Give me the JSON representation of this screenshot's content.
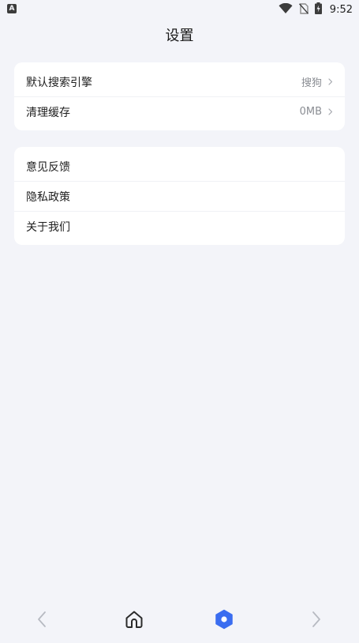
{
  "status_bar": {
    "left_icon_letter": "A",
    "time": "9:52",
    "icons": [
      "wifi-icon",
      "no-sim-icon",
      "battery-charging-icon"
    ]
  },
  "page": {
    "title": "设置"
  },
  "group1": {
    "items": [
      {
        "label": "默认搜索引擎",
        "value": "搜狗"
      },
      {
        "label": "清理缓存",
        "value": "0MB"
      }
    ]
  },
  "group2": {
    "items": [
      {
        "label": "意见反馈"
      },
      {
        "label": "隐私政策"
      },
      {
        "label": "关于我们"
      }
    ]
  },
  "bottom_nav": {
    "items": [
      "back-icon",
      "home-icon",
      "settings-icon",
      "forward-icon"
    ],
    "active": "settings-icon",
    "active_color": "#3a6df0",
    "inactive_color": "#b7bac2",
    "home_color": "#2b2b2b"
  },
  "colors": {
    "background": "#f3f4f9",
    "card": "#ffffff",
    "secondary_text": "#8a8d93"
  }
}
